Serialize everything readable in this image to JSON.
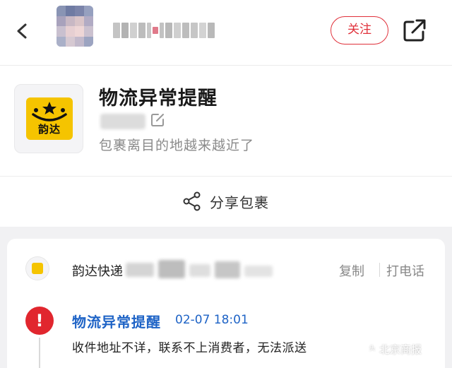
{
  "header": {
    "follow_label": "关注",
    "icons": {
      "back": "back-arrow-icon",
      "share": "share-out-icon"
    }
  },
  "card": {
    "title": "物流异常提醒",
    "subtitle": "包裹离目的地越来越近了",
    "logo_text": "韵达",
    "share_label": "分享包裹",
    "colors": {
      "logo_bg": "#f5c400"
    }
  },
  "panel": {
    "courier": "韵达快递",
    "copy_label": "复制",
    "call_label": "打电话",
    "notice_title": "物流异常提醒",
    "notice_time": "02-07 18:01",
    "notice_body": "收件地址不详，联系不上消费者，无法派送",
    "alert_symbol": "!",
    "colors": {
      "alert": "#e1262e",
      "link": "#1e63c6"
    }
  },
  "watermark": {
    "text": "北京商报",
    "badge": "头"
  }
}
